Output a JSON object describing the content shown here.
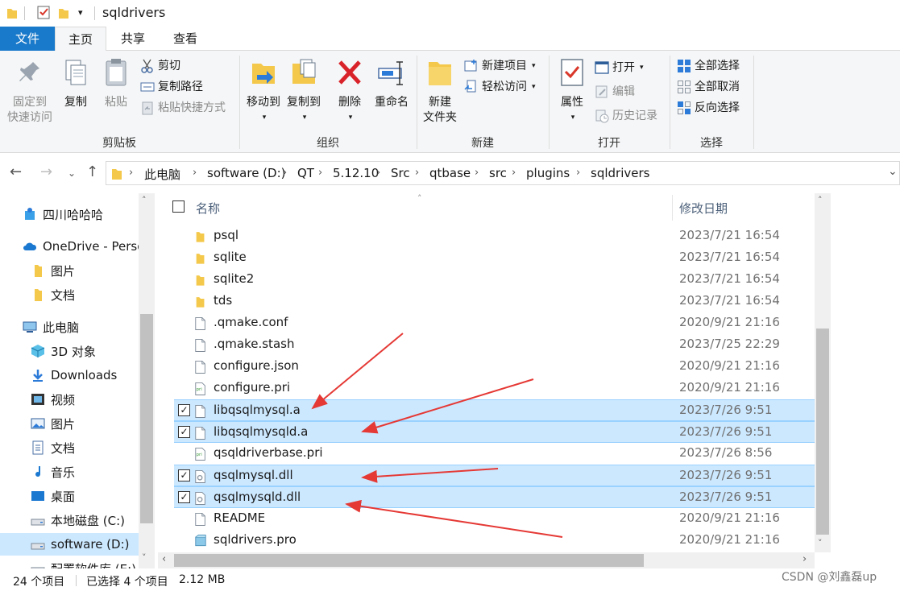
{
  "title_bar": {
    "folder_name": "sqldrivers"
  },
  "ribbon_tabs": [
    "文件",
    "主页",
    "共享",
    "查看"
  ],
  "ribbon": {
    "clipboard": {
      "pin_line1": "固定到",
      "pin_line2": "快速访问",
      "copy": "复制",
      "paste": "粘贴",
      "cut": "剪切",
      "copy_path": "复制路径",
      "paste_shortcut": "粘贴快捷方式",
      "group_label": "剪贴板"
    },
    "organize": {
      "move_to": "移动到",
      "copy_to": "复制到",
      "delete": "删除",
      "rename": "重命名",
      "group_label": "组织"
    },
    "new": {
      "new_folder_line1": "新建",
      "new_folder_line2": "文件夹",
      "new_item": "新建项目",
      "easy_access": "轻松访问",
      "group_label": "新建"
    },
    "open": {
      "properties": "属性",
      "open": "打开",
      "edit": "编辑",
      "history": "历史记录",
      "group_label": "打开"
    },
    "select": {
      "select_all": "全部选择",
      "select_none": "全部取消",
      "invert": "反向选择",
      "group_label": "选择"
    }
  },
  "breadcrumbs": [
    "此电脑",
    "software (D:)",
    "QT",
    "5.12.10",
    "Src",
    "qtbase",
    "src",
    "plugins",
    "sqldrivers"
  ],
  "sidebar": [
    {
      "label": "四川哈哈哈",
      "icon": "user-folder-icon",
      "indent": 0
    },
    {
      "label": "OneDrive - Perso",
      "icon": "cloud-icon",
      "indent": 0
    },
    {
      "label": "图片",
      "icon": "folder-icon",
      "indent": 1
    },
    {
      "label": "文档",
      "icon": "folder-icon",
      "indent": 1
    },
    {
      "label": "此电脑",
      "icon": "computer-icon",
      "indent": 0
    },
    {
      "label": "3D 对象",
      "icon": "cube-icon",
      "indent": 1
    },
    {
      "label": "Downloads",
      "icon": "download-icon",
      "indent": 1
    },
    {
      "label": "视频",
      "icon": "video-icon",
      "indent": 1
    },
    {
      "label": "图片",
      "icon": "picture-icon",
      "indent": 1
    },
    {
      "label": "文档",
      "icon": "document-icon",
      "indent": 1
    },
    {
      "label": "音乐",
      "icon": "music-icon",
      "indent": 1
    },
    {
      "label": "桌面",
      "icon": "desktop-icon",
      "indent": 1
    },
    {
      "label": "本地磁盘 (C:)",
      "icon": "drive-icon",
      "indent": 1
    },
    {
      "label": "software (D:)",
      "icon": "drive-icon",
      "indent": 1,
      "selected": true
    },
    {
      "label": "配置软件库 (E:)",
      "icon": "drive-icon",
      "indent": 1
    }
  ],
  "file_list": {
    "columns": {
      "name": "名称",
      "modified": "修改日期"
    },
    "rows": [
      {
        "name": "psql",
        "date": "2023/7/21 16:54",
        "type": "folder",
        "selected": false
      },
      {
        "name": "sqlite",
        "date": "2023/7/21 16:54",
        "type": "folder",
        "selected": false
      },
      {
        "name": "sqlite2",
        "date": "2023/7/21 16:54",
        "type": "folder",
        "selected": false
      },
      {
        "name": "tds",
        "date": "2023/7/21 16:54",
        "type": "folder",
        "selected": false
      },
      {
        "name": ".qmake.conf",
        "date": "2020/9/21 21:16",
        "type": "file",
        "selected": false
      },
      {
        "name": ".qmake.stash",
        "date": "2023/7/25 22:29",
        "type": "file",
        "selected": false
      },
      {
        "name": "configure.json",
        "date": "2020/9/21 21:16",
        "type": "file",
        "selected": false
      },
      {
        "name": "configure.pri",
        "date": "2020/9/21 21:16",
        "type": "pri",
        "selected": false
      },
      {
        "name": "libqsqlmysql.a",
        "date": "2023/7/26 9:51",
        "type": "file",
        "selected": true
      },
      {
        "name": "libqsqlmysqld.a",
        "date": "2023/7/26 9:51",
        "type": "file",
        "selected": true
      },
      {
        "name": "qsqldriverbase.pri",
        "date": "2023/7/26 8:56",
        "type": "pri",
        "selected": false
      },
      {
        "name": "qsqlmysql.dll",
        "date": "2023/7/26 9:51",
        "type": "dll",
        "selected": true
      },
      {
        "name": "qsqlmysqld.dll",
        "date": "2023/7/26 9:51",
        "type": "dll",
        "selected": true
      },
      {
        "name": "README",
        "date": "2020/9/21 21:16",
        "type": "file",
        "selected": false
      },
      {
        "name": "sqldrivers.pro",
        "date": "2020/9/21 21:16",
        "type": "pro",
        "selected": false
      }
    ]
  },
  "status": {
    "count": "24 个项目",
    "selected": "已选择 4 个项目",
    "size": "2.12 MB"
  },
  "watermark": "CSDN @刘鑫磊up",
  "colors": {
    "accent": "#1979ca",
    "selection": "#cce8ff",
    "annotation_arrow": "#e53935"
  }
}
